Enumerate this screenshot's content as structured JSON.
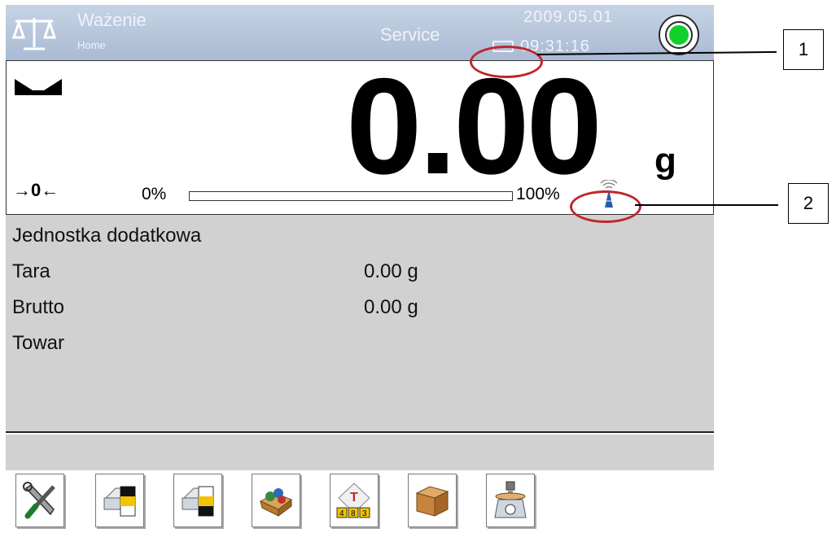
{
  "header": {
    "title": "Ważenie",
    "subtitle": "Home",
    "mode": "Service",
    "date": "2009.05.01",
    "time": "09:31:16",
    "status_color": "#12d02b"
  },
  "weighing": {
    "reading": "0.00",
    "unit": "g",
    "zero_indicator": "→0←",
    "range_min": "0%",
    "range_max": "100%",
    "range_fill": 0,
    "stable_icon": "stability-marker-icon",
    "signal_icon": "wireless-antenna-icon"
  },
  "info": {
    "extra_unit_label": "Jednostka dodatkowa",
    "rows": [
      {
        "label": "Tara",
        "value": "0.00 g"
      },
      {
        "label": "Brutto",
        "value": "0.00 g"
      },
      {
        "label": "Towar",
        "value": ""
      }
    ]
  },
  "toolbar": {
    "buttons": [
      "tools-icon",
      "printer-header-icon",
      "printer-footer-icon",
      "product-database-icon",
      "tare-icon",
      "packaging-icon",
      "weighing-icon"
    ]
  },
  "callouts": [
    {
      "label": "1"
    },
    {
      "label": "2"
    }
  ],
  "colors": {
    "header": "#b8c7dc",
    "panel": "#d1d1d1",
    "callout": "#c0262b"
  }
}
